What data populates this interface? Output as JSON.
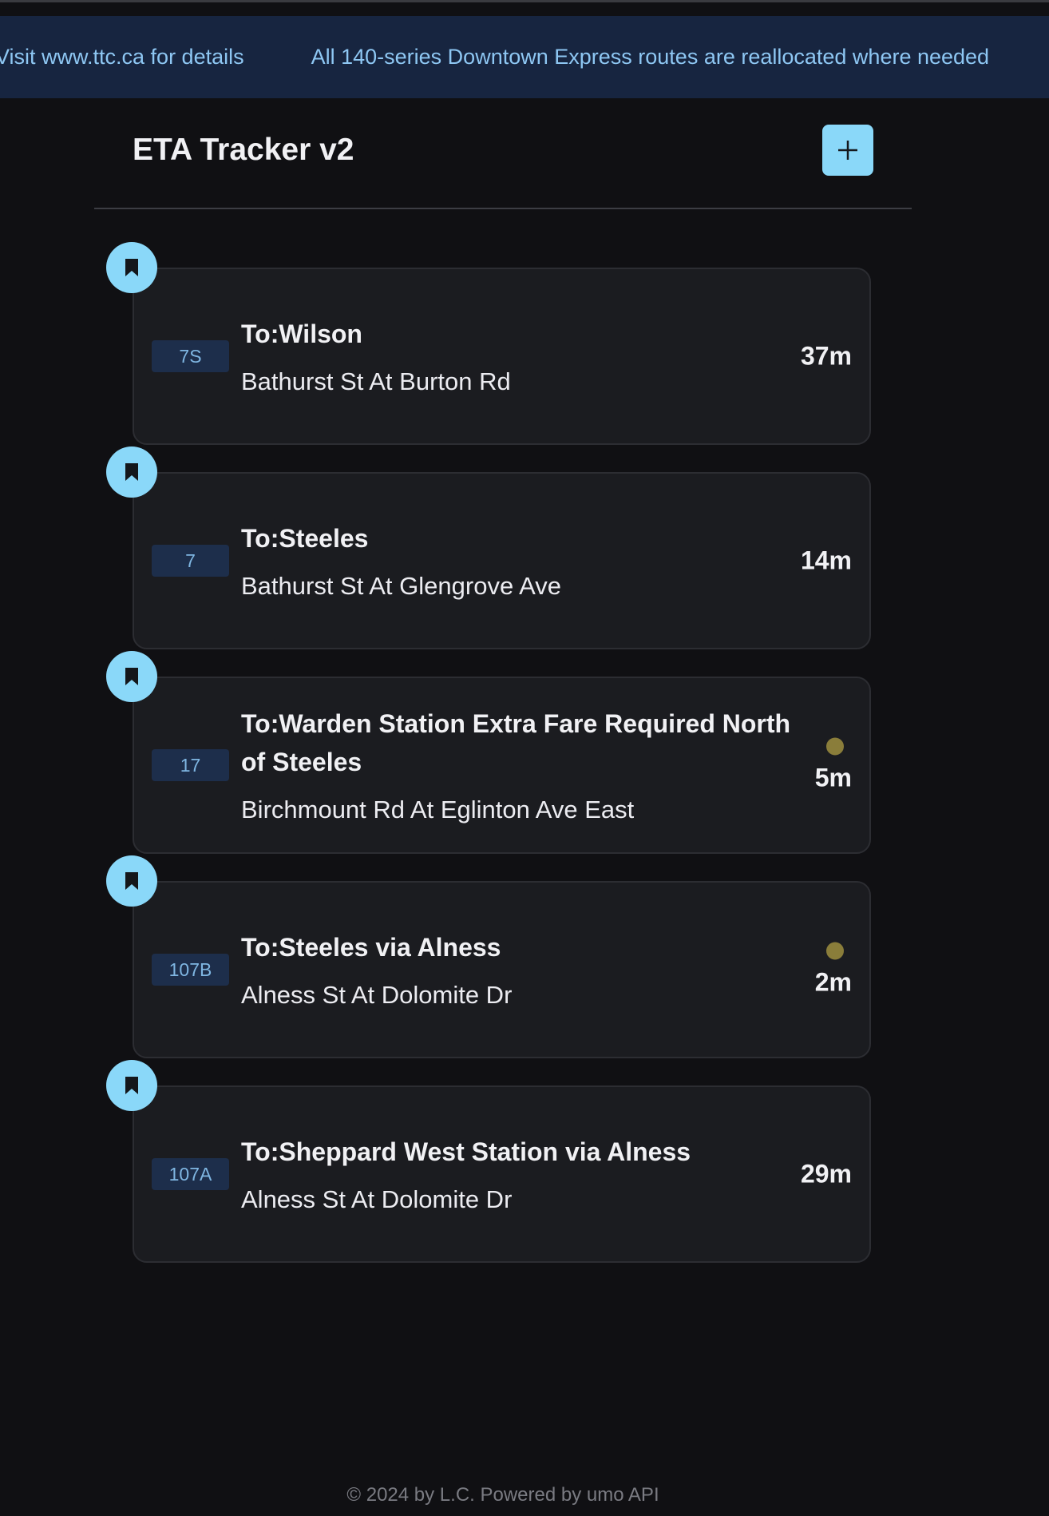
{
  "alert_banner": {
    "messages": [
      "Visit www.ttc.ca for details",
      "All 140-series Downtown Express routes are reallocated where needed"
    ]
  },
  "header": {
    "title": "ETA Tracker v2",
    "add_button_icon": "plus-icon"
  },
  "colors": {
    "accent": "#8ad8f9",
    "background": "#101013",
    "card": "#1b1c20",
    "banner": "#172540",
    "live_indicator": "#8a7d3a"
  },
  "stops": [
    {
      "route": "7S",
      "destination": "To:Wilson",
      "stop": "Bathurst St At Burton Rd",
      "eta": "37m",
      "live": false
    },
    {
      "route": "7",
      "destination": "To:Steeles",
      "stop": "Bathurst St At Glengrove Ave",
      "eta": "14m",
      "live": false
    },
    {
      "route": "17",
      "destination": "To:Warden Station Extra Fare Required North of Steeles",
      "stop": "Birchmount Rd At Eglinton Ave East",
      "eta": "5m",
      "live": true
    },
    {
      "route": "107B",
      "destination": "To:Steeles via Alness",
      "stop": "Alness St At Dolomite Dr",
      "eta": "2m",
      "live": true
    },
    {
      "route": "107A",
      "destination": "To:Sheppard West Station via Alness",
      "stop": "Alness St At Dolomite Dr",
      "eta": "29m",
      "live": false
    }
  ],
  "footer": {
    "text": "© 2024 by L.C. Powered by umo API"
  }
}
